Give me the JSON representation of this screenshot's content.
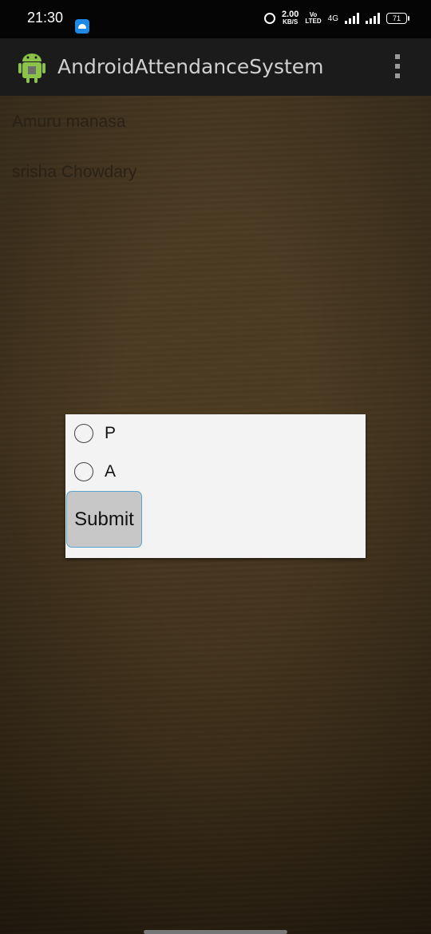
{
  "status_bar": {
    "time": "21:30",
    "net_speed_value": "2.00",
    "net_speed_unit": "KB/S",
    "volte_top": "Vo",
    "volte_bottom": "LTED",
    "network_type": "4G",
    "battery_level": "71"
  },
  "app_bar": {
    "title": "AndroidAttendanceSystem",
    "logo_icon": "android-icon",
    "overflow_icon": "more-vert-icon"
  },
  "students": [
    {
      "name": "Amuru manasa"
    },
    {
      "name": "srisha Chowdary"
    }
  ],
  "dialog": {
    "options": [
      {
        "label": "P",
        "selected": false
      },
      {
        "label": "A",
        "selected": false
      }
    ],
    "submit_label": "Submit"
  },
  "colors": {
    "app_bar": "#1b1b1b",
    "status_bar": "#050505",
    "dialog_bg": "#f3f3f3",
    "button_bg": "#c7c7c7",
    "button_border": "#5aa4cf",
    "wood_bg": "#4a3a22"
  }
}
